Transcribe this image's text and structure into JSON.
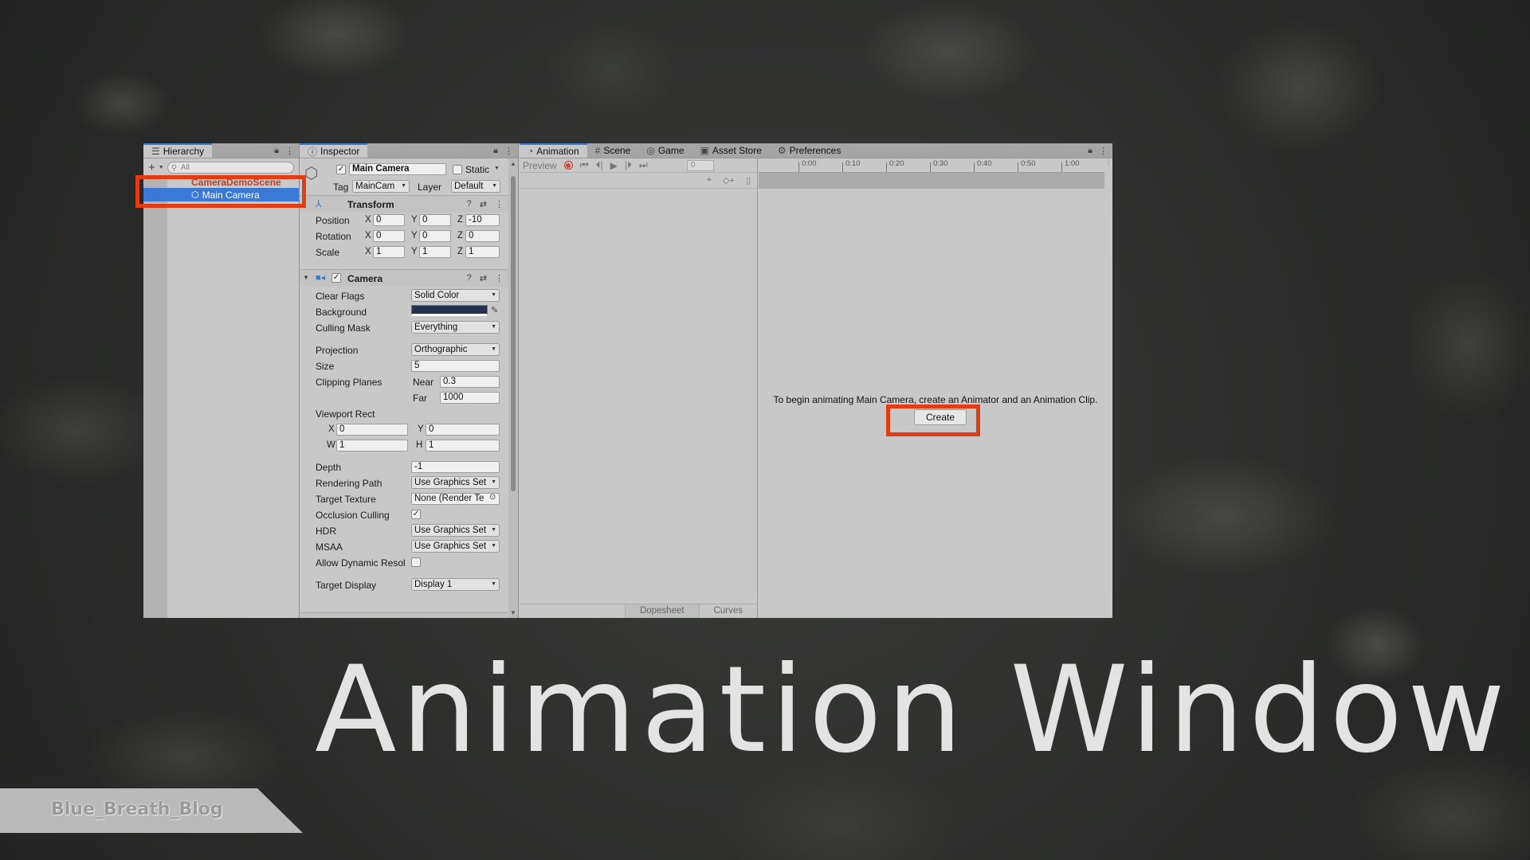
{
  "hierarchy": {
    "tab": "Hierarchy",
    "search_placeholder": "All",
    "scene": "CameraDemoScene",
    "selected_item": "Main Camera"
  },
  "inspector": {
    "tab": "Inspector",
    "object_name": "Main Camera",
    "static_label": "Static",
    "tag_label": "Tag",
    "tag_value": "MainCam",
    "layer_label": "Layer",
    "layer_value": "Default",
    "transform": {
      "title": "Transform",
      "position_label": "Position",
      "rotation_label": "Rotation",
      "scale_label": "Scale",
      "axis_x": "X",
      "axis_y": "Y",
      "axis_z": "Z",
      "position": [
        "0",
        "0",
        "-10"
      ],
      "rotation": [
        "0",
        "0",
        "0"
      ],
      "scale": [
        "1",
        "1",
        "1"
      ]
    },
    "camera": {
      "title": "Camera",
      "clear_flags_label": "Clear Flags",
      "clear_flags": "Solid Color",
      "background_label": "Background",
      "background_color": "#23314f",
      "culling_mask_label": "Culling Mask",
      "culling_mask": "Everything",
      "projection_label": "Projection",
      "projection": "Orthographic",
      "size_label": "Size",
      "size": "5",
      "clipping_label": "Clipping Planes",
      "near_label": "Near",
      "near": "0.3",
      "far_label": "Far",
      "far": "1000",
      "viewport_label": "Viewport Rect",
      "vp_x_label": "X",
      "vp_x": "0",
      "vp_y_label": "Y",
      "vp_y": "0",
      "vp_w_label": "W",
      "vp_w": "1",
      "vp_h_label": "H",
      "vp_h": "1",
      "depth_label": "Depth",
      "depth": "-1",
      "rendering_path_label": "Rendering Path",
      "rendering_path": "Use Graphics Set",
      "target_texture_label": "Target Texture",
      "target_texture": "None (Render Te",
      "occlusion_label": "Occlusion Culling",
      "occlusion_checked": true,
      "hdr_label": "HDR",
      "hdr": "Use Graphics Set",
      "msaa_label": "MSAA",
      "msaa": "Use Graphics Set",
      "dynamic_res_label": "Allow Dynamic Resol",
      "dynamic_res_checked": false,
      "target_display_label": "Target Display",
      "target_display": "Display 1"
    }
  },
  "animation": {
    "tabs": [
      "Animation",
      "Scene",
      "Game",
      "Asset Store",
      "Preferences"
    ],
    "preview_label": "Preview",
    "frame": "0",
    "ruler": [
      "0:00",
      "0:10",
      "0:20",
      "0:30",
      "0:40",
      "0:50",
      "1:00"
    ],
    "message": "To begin animating Main Camera, create an Animator and an Animation Clip.",
    "create_button": "Create",
    "dopesheet_label": "Dopesheet",
    "curves_label": "Curves"
  },
  "overlay": {
    "title": "Animation Window",
    "watermark": "Blue_Breath_Blog",
    "highlight_color": "#e23d12"
  }
}
